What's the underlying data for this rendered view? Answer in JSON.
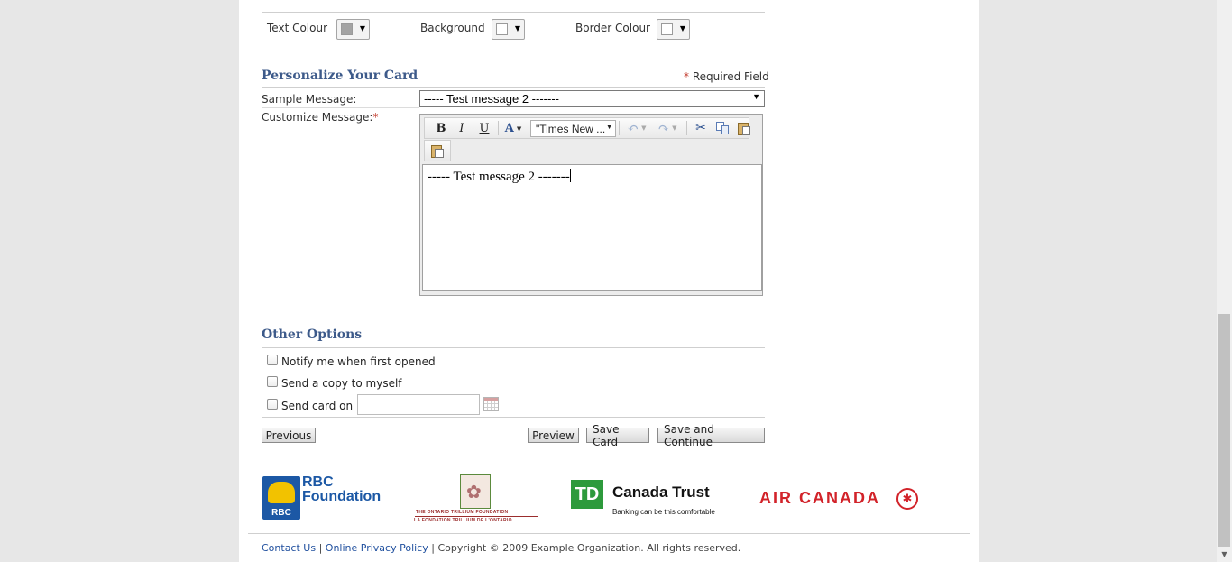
{
  "colors": {
    "labels": {
      "text_colour": "Text Colour",
      "background": "Background",
      "border_colour": "Border Colour"
    },
    "values": {
      "text_colour": "#a3a3a3",
      "background": "#ffffff",
      "border_colour": "#ffffff"
    }
  },
  "personalize": {
    "title": "Personalize Your Card",
    "required_star": "*",
    "required_text": "Required Field",
    "sample_label": "Sample Message:",
    "sample_value": "----- Test message 2 -------",
    "customize_label": "Customize Message:",
    "customize_star": "*",
    "editor": {
      "bold": "B",
      "italic": "I",
      "underline": "U",
      "text_color": "A",
      "font_value": "\"Times New ...",
      "content": "----- Test message 2 -------"
    }
  },
  "other_options": {
    "title": "Other Options",
    "notify": "Notify me when first opened",
    "copy": "Send a copy to myself",
    "send_on": "Send card on",
    "send_on_value": ""
  },
  "buttons": {
    "previous": "Previous",
    "preview": "Preview",
    "save_card": "Save Card",
    "save_continue": "Save and Continue"
  },
  "sponsors": {
    "rbc_mark": "RBC",
    "rbc_line1": "RBC",
    "rbc_line2": "Foundation",
    "trillium_line1": "THE ONTARIO TRILLIUM FOUNDATION",
    "trillium_line2": "LA FONDATION TRILLIUM DE L'ONTARIO",
    "td_mark": "TD",
    "td_name": "Canada Trust",
    "td_tagline": "Banking can be this comfortable",
    "ac_name": "AIR CANADA"
  },
  "footer": {
    "contact": "Contact Us",
    "sep1": "|",
    "privacy": "Online Privacy Policy",
    "sep2": "|",
    "copyright": "Copyright © 2009 Example Organization. All rights reserved."
  }
}
